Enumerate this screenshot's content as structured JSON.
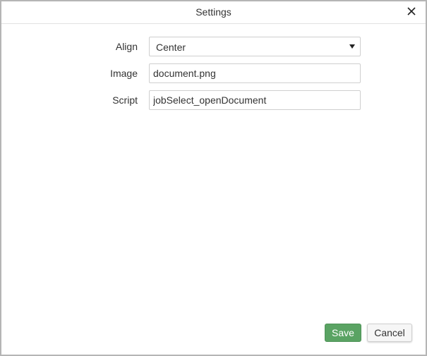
{
  "dialog": {
    "title": "Settings"
  },
  "form": {
    "align": {
      "label": "Align",
      "value": "Center"
    },
    "image": {
      "label": "Image",
      "value": "document.png"
    },
    "script": {
      "label": "Script",
      "value": "jobSelect_openDocument"
    }
  },
  "footer": {
    "save_label": "Save",
    "cancel_label": "Cancel"
  },
  "icons": {
    "close": "close-icon",
    "dropdown": "caret-down-icon"
  },
  "colors": {
    "save_button": "#5aa363",
    "border": "#b5b5b5"
  }
}
